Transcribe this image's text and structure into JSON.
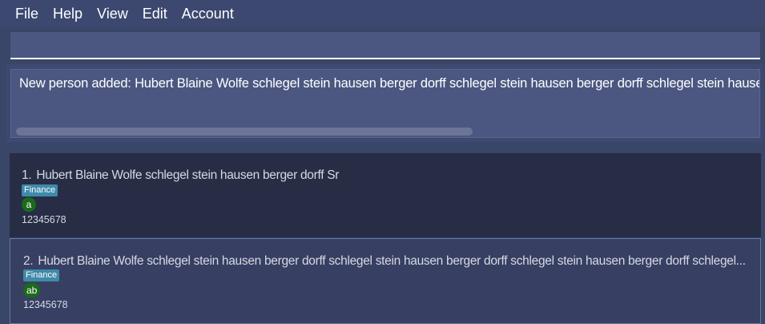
{
  "menu": {
    "items": [
      {
        "label": "File"
      },
      {
        "label": "Help"
      },
      {
        "label": "View"
      },
      {
        "label": "Edit"
      },
      {
        "label": "Account"
      }
    ]
  },
  "command": {
    "value": "",
    "placeholder": ""
  },
  "result": {
    "message": "New person added: Hubert Blaine Wolfe schlegel stein hausen berger dorff schlegel stein hausen berger dorff schlegel stein hausen berger dorff"
  },
  "persons": [
    {
      "index": "1.",
      "name": "Hubert Blaine Wolfe schlegel stein hausen berger dorff Sr",
      "tag": "Finance",
      "badge": "a",
      "phone": "12345678"
    },
    {
      "index": "2.",
      "name": "Hubert Blaine Wolfe schlegel stein hausen berger dorff schlegel stein hausen berger dorff schlegel stein hausen berger dorff schlegel...",
      "tag": "Finance",
      "badge": "ab",
      "phone": "12345678"
    }
  ],
  "colors": {
    "background": "#3a4668",
    "field": "#4b5780",
    "card_dark": "#262d45",
    "card_selected": "#373f62",
    "tag": "#3f8aa8",
    "badge": "#1b6a1b"
  }
}
